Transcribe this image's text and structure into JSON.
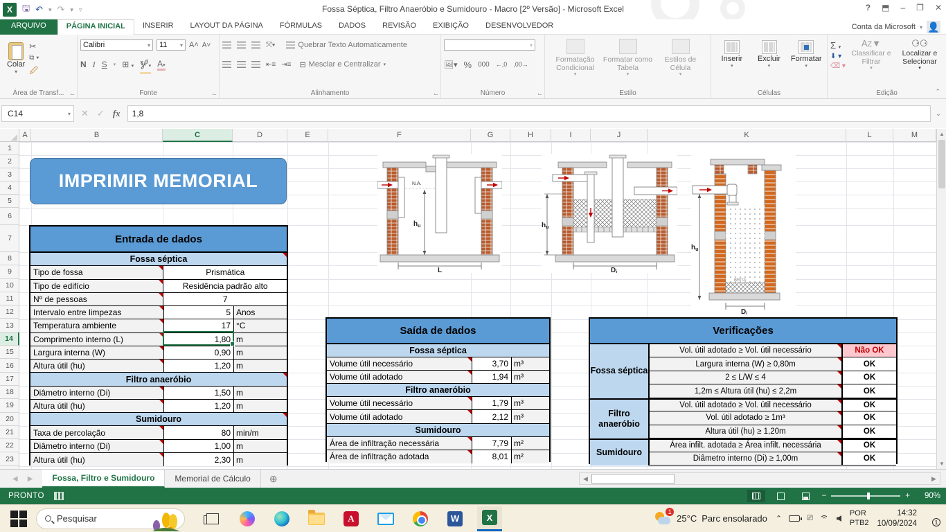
{
  "colors": {
    "excel_green": "#217346",
    "header_blue": "#5B9BD5",
    "subheader_blue": "#BDD7EE",
    "nok_bg": "#FFC7CE",
    "nok_text": "#C00000"
  },
  "window": {
    "title": "Fossa Séptica, Filtro Anaeróbio e Sumidouro - Macro [2º Versão] - Microsoft Excel",
    "help": "?",
    "minimize": "–",
    "restore": "❐",
    "close": "✕",
    "ribbon_opts": "⬒"
  },
  "ribbon": {
    "tabs": [
      "ARQUIVO",
      "PÁGINA INICIAL",
      "INSERIR",
      "LAYOUT DA PÁGINA",
      "FÓRMULAS",
      "DADOS",
      "REVISÃO",
      "EXIBIÇÃO",
      "DESENVOLVEDOR"
    ],
    "active_tab_index": 1,
    "account": "Conta da Microsoft",
    "clipboard": {
      "paste": "Colar",
      "group": "Área de Transf..."
    },
    "font": {
      "name": "Calibri",
      "size": "11",
      "bold": "N",
      "italic": "I",
      "underline": "S",
      "group": "Fonte"
    },
    "alignment": {
      "wrap": "Quebrar Texto Automaticamente",
      "merge": "Mesclar e Centralizar",
      "group": "Alinhamento"
    },
    "number": {
      "percent": "%",
      "thousands": "000",
      "inc": ",0",
      "dec": ",00",
      "group": "Número"
    },
    "style": {
      "cond": "Formatação Condicional",
      "table": "Formatar como Tabela",
      "cellstyles": "Estilos de Célula",
      "group": "Estilo"
    },
    "cells": {
      "insert": "Inserir",
      "delete": "Excluir",
      "format": "Formatar",
      "group": "Células"
    },
    "editing": {
      "autosum": "Σ",
      "sort": "Classificar e Filtrar",
      "find": "Localizar e Selecionar",
      "group": "Edição"
    }
  },
  "formula_bar": {
    "cell_ref": "C14",
    "value": "1,8",
    "fx": "fx"
  },
  "grid": {
    "columns": [
      "A",
      "B",
      "C",
      "D",
      "E",
      "F",
      "G",
      "H",
      "I",
      "J",
      "K",
      "L",
      "M"
    ],
    "selected_column": "C",
    "rows": [
      1,
      2,
      3,
      4,
      5,
      6,
      7,
      8,
      9,
      10,
      11,
      12,
      13,
      14,
      15,
      16,
      17,
      18,
      19,
      20,
      21,
      22,
      23
    ],
    "selected_row": 14
  },
  "sheet": {
    "print_button": "IMPRIMIR MEMORIAL",
    "entrada": {
      "title": "Entrada de dados",
      "sections": [
        {
          "header": "Fossa séptica",
          "rows": [
            {
              "label": "Tipo de fossa",
              "value": "Prismática",
              "unit": "",
              "span": true
            },
            {
              "label": "Tipo de edifício",
              "value": "Residência padrão alto",
              "unit": "",
              "span": true
            },
            {
              "label": "Nº de pessoas",
              "value": "7",
              "unit": "",
              "span": true
            },
            {
              "label": "Intervalo entre limpezas",
              "value": "5",
              "unit": "Anos"
            },
            {
              "label": "Temperatura ambiente",
              "value": "17",
              "unit": "°C"
            },
            {
              "label": "Comprimento interno (L)",
              "value": "1,80",
              "unit": "m",
              "selected": true
            },
            {
              "label": "Largura interna (W)",
              "value": "0,90",
              "unit": "m"
            },
            {
              "label": "Altura útil (hu)",
              "value": "1,20",
              "unit": "m"
            }
          ]
        },
        {
          "header": "Filtro anaeróbio",
          "rows": [
            {
              "label": "Diâmetro interno (Di)",
              "value": "1,50",
              "unit": "m"
            },
            {
              "label": "Altura útil (hu)",
              "value": "1,20",
              "unit": "m"
            }
          ]
        },
        {
          "header": "Sumidouro",
          "rows": [
            {
              "label": "Taxa de percolação",
              "value": "80",
              "unit": "min/m"
            },
            {
              "label": "Diâmetro interno (Di)",
              "value": "1,00",
              "unit": "m"
            },
            {
              "label": "Altura útil (hu)",
              "value": "2,30",
              "unit": "m"
            }
          ]
        }
      ]
    },
    "saida": {
      "title": "Saída de dados",
      "sections": [
        {
          "header": "Fossa séptica",
          "rows": [
            {
              "label": "Volume útil necessário",
              "value": "3,70",
              "unit": "m³"
            },
            {
              "label": "Volume útil adotado",
              "value": "1,94",
              "unit": "m³"
            }
          ]
        },
        {
          "header": "Filtro anaeróbio",
          "rows": [
            {
              "label": "Volume útil necessário",
              "value": "1,79",
              "unit": "m³"
            },
            {
              "label": "Volume útil adotado",
              "value": "2,12",
              "unit": "m³"
            }
          ]
        },
        {
          "header": "Sumidouro",
          "rows": [
            {
              "label": "Área de infiltração necessária",
              "value": "7,79",
              "unit": "m²"
            },
            {
              "label": "Área de infiltração adotada",
              "value": "8,01",
              "unit": "m²"
            }
          ]
        }
      ]
    },
    "verificacoes": {
      "title": "Verificações",
      "groups": [
        {
          "name": "Fossa séptica",
          "rows": [
            {
              "criterion": "Vol. útil adotado ≥ Vol. útil necessário",
              "status": "Não OK",
              "ok": false
            },
            {
              "criterion": "Largura interna (W) ≥ 0,80m",
              "status": "OK",
              "ok": true
            },
            {
              "criterion": "2 ≤ L/W ≤ 4",
              "status": "OK",
              "ok": true
            },
            {
              "criterion": "1,2m ≤ Altura útil (hu) ≤ 2,2m",
              "status": "OK",
              "ok": true
            }
          ]
        },
        {
          "name": "Filtro anaeróbio",
          "rows": [
            {
              "criterion": "Vol. útil adotado ≥ Vol. útil necessário",
              "status": "OK",
              "ok": true
            },
            {
              "criterion": "Vol. útil adotado ≥ 1m³",
              "status": "OK",
              "ok": true
            },
            {
              "criterion": "Altura útil (hu) ≥ 1,20m",
              "status": "OK",
              "ok": true
            }
          ]
        },
        {
          "name": "Sumidouro",
          "rows": [
            {
              "criterion": "Área infilt. adotada ≥ Área infilt. necessária",
              "status": "OK",
              "ok": true
            },
            {
              "criterion": "Diâmetro interno (Di) ≥ 1,00m",
              "status": "OK",
              "ok": true
            }
          ]
        }
      ]
    },
    "diagrams": {
      "h": "h",
      "h_sub": "u",
      "L": "L",
      "D": "D",
      "D_sub": "i",
      "na": "N.A.",
      "brita": "BRITA"
    }
  },
  "sheet_tabs": {
    "tab1": "Fossa, Filtro e Sumidouro",
    "tab2": "Memorial de Cálculo",
    "add": "+"
  },
  "status_bar": {
    "mode": "PRONTO",
    "zoom": "90%"
  },
  "taskbar": {
    "search_placeholder": "Pesquisar",
    "weather_temp": "25°C",
    "weather_desc": "Parc ensolarado",
    "weather_badge": "1",
    "lang_line1": "POR",
    "lang_line2": "PTB2",
    "time": "14:32",
    "date": "10/09/2024",
    "notif_badge": "1"
  }
}
